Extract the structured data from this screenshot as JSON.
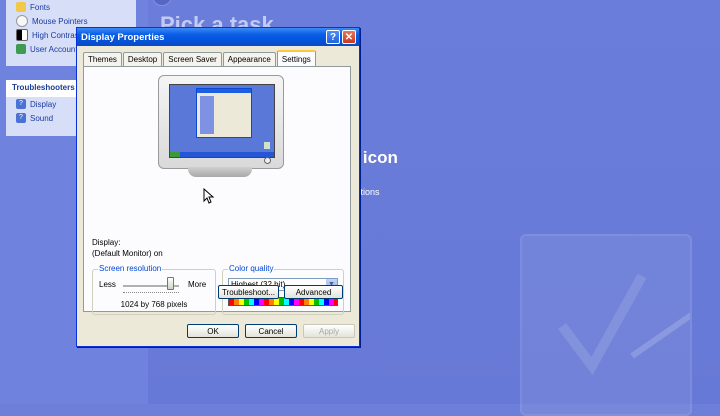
{
  "background": {
    "heading": "Pick a task...",
    "heading2": "el icon",
    "small_text": "ctions",
    "sidebar": {
      "see_also_items": [
        {
          "label": "Fonts",
          "icon": "folder-icon"
        },
        {
          "label": "Mouse Pointers",
          "icon": "mouse-icon"
        },
        {
          "label": "High Contrast",
          "icon": "contrast-icon"
        },
        {
          "label": "User Accounts",
          "icon": "users-icon"
        }
      ],
      "troubleshooters": {
        "title": "Troubleshooters",
        "items": [
          {
            "label": "Display",
            "icon": "help-icon"
          },
          {
            "label": "Sound",
            "icon": "help-icon"
          }
        ]
      }
    }
  },
  "dialog": {
    "title": "Display Properties",
    "help_label": "?",
    "close_label": "✕",
    "tabs": [
      "Themes",
      "Desktop",
      "Screen Saver",
      "Appearance",
      "Settings"
    ],
    "active_tab": "Settings",
    "display_label": "Display:",
    "display_value": "(Default Monitor) on",
    "resolution": {
      "title": "Screen resolution",
      "less": "Less",
      "more": "More",
      "value_text": "1024 by 768 pixels"
    },
    "color_quality": {
      "title": "Color quality",
      "selected": "Highest (32 bit)"
    },
    "troubleshoot_label": "Troubleshoot...",
    "advanced_label": "Advanced",
    "ok_label": "OK",
    "cancel_label": "Cancel",
    "apply_label": "Apply"
  }
}
